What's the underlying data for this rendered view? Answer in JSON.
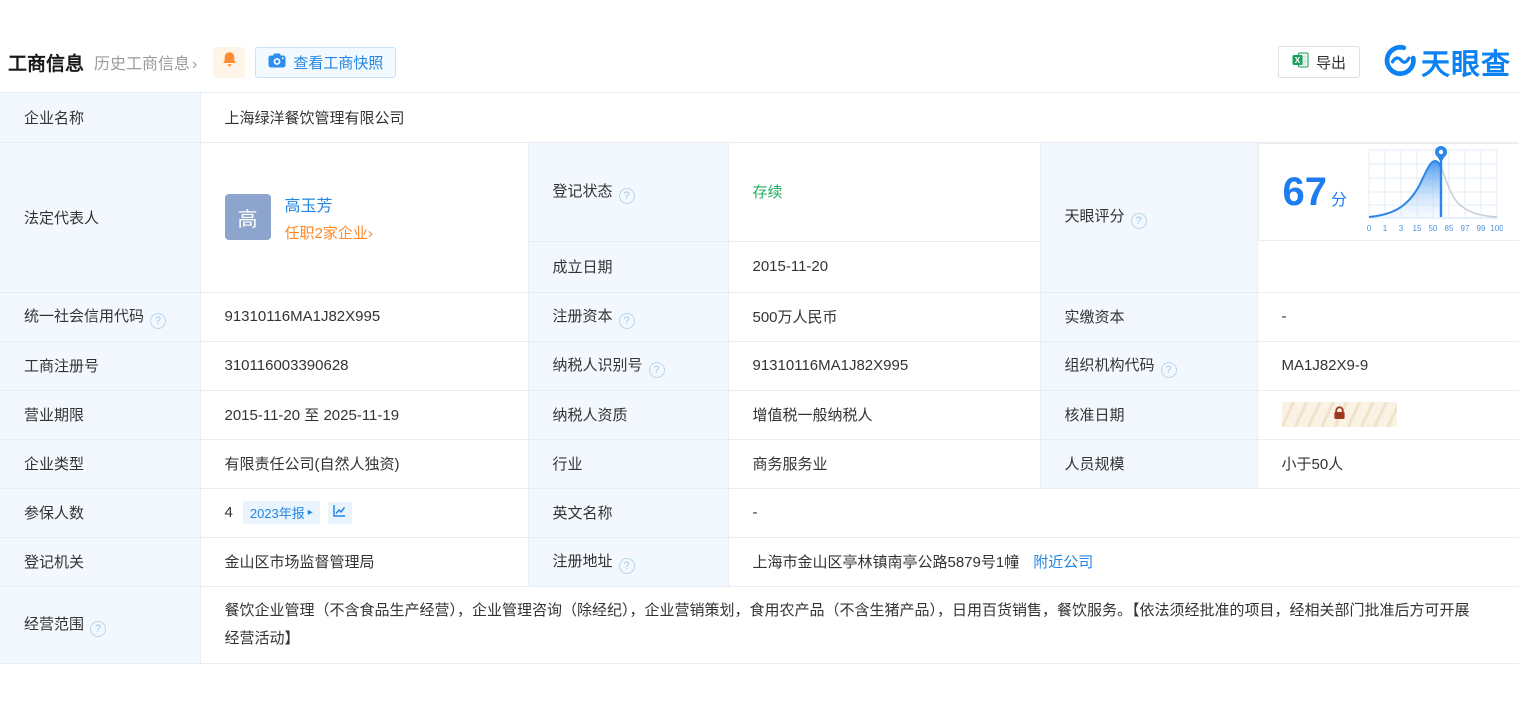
{
  "glyphs": {
    "help": "?",
    "chevron": "›",
    "tag_arrow": "▸"
  },
  "colors": {
    "accent_blue": "#2386e2",
    "brand_blue": "#0c82f2",
    "label_bg": "#f2f8fd",
    "border": "#e9eef3",
    "status_green": "#21ad62",
    "orange": "#ff8a2b",
    "score_blue": "#1d7df0",
    "lock_red": "#9c3a1e",
    "avatar_bg": "#8da5cc"
  },
  "header": {
    "title": "工商信息",
    "history_link": "历史工商信息",
    "snapshot_label": "查看工商快照",
    "export_label": "导出",
    "brand_name": "天眼查"
  },
  "fields": {
    "company_name": {
      "label": "企业名称",
      "value": "上海绿洋餐饮管理有限公司"
    },
    "legal_rep": {
      "label": "法定代表人",
      "avatar": "高",
      "name": "高玉芳",
      "positions": "任职2家企业"
    },
    "reg_status": {
      "label": "登记状态",
      "value": "存续"
    },
    "establish_date": {
      "label": "成立日期",
      "value": "2015-11-20"
    },
    "score": {
      "label": "天眼评分",
      "value": "67",
      "unit": "分"
    },
    "credit_code": {
      "label": "统一社会信用代码",
      "value": "91310116MA1J82X995"
    },
    "reg_capital": {
      "label": "注册资本",
      "value": "500万人民币"
    },
    "paid_capital": {
      "label": "实缴资本",
      "value": "-"
    },
    "reg_number": {
      "label": "工商注册号",
      "value": "310116003390628"
    },
    "taxpayer_id": {
      "label": "纳税人识别号",
      "value": "91310116MA1J82X995"
    },
    "org_code": {
      "label": "组织机构代码",
      "value": "MA1J82X9-9"
    },
    "business_term": {
      "label": "营业期限",
      "value": "2015-11-20 至 2025-11-19"
    },
    "taxpayer_quality": {
      "label": "纳税人资质",
      "value": "增值税一般纳税人"
    },
    "approval_date": {
      "label": "核准日期"
    },
    "company_type": {
      "label": "企业类型",
      "value": "有限责任公司(自然人独资)"
    },
    "industry": {
      "label": "行业",
      "value": "商务服务业"
    },
    "staff_size": {
      "label": "人员规模",
      "value": "小于50人"
    },
    "insured_count": {
      "label": "参保人数",
      "value": "4",
      "report_tag": "2023年报"
    },
    "english_name": {
      "label": "英文名称",
      "value": "-"
    },
    "reg_authority": {
      "label": "登记机关",
      "value": "金山区市场监督管理局"
    },
    "reg_address": {
      "label": "注册地址",
      "value": "上海市金山区亭林镇南亭公路5879号1幢",
      "nearby_link": "附近公司"
    },
    "business_scope": {
      "label": "经营范围",
      "value": "餐饮企业管理（不含食品生产经营），企业管理咨询（除经纪），企业营销策划，食用农产品（不含生猪产品），日用百货销售，餐饮服务。【依法须经批准的项目，经相关部门批准后方可开展经营活动】"
    }
  },
  "chart_data": {
    "type": "area",
    "title": "天眼评分分布曲线",
    "score": 67,
    "tick_labels": [
      "0",
      "1",
      "3",
      "15",
      "50",
      "85",
      "97",
      "99",
      "100"
    ],
    "marker_value": 67,
    "xlabel": "",
    "ylabel": "",
    "legend": false,
    "grid": true
  }
}
